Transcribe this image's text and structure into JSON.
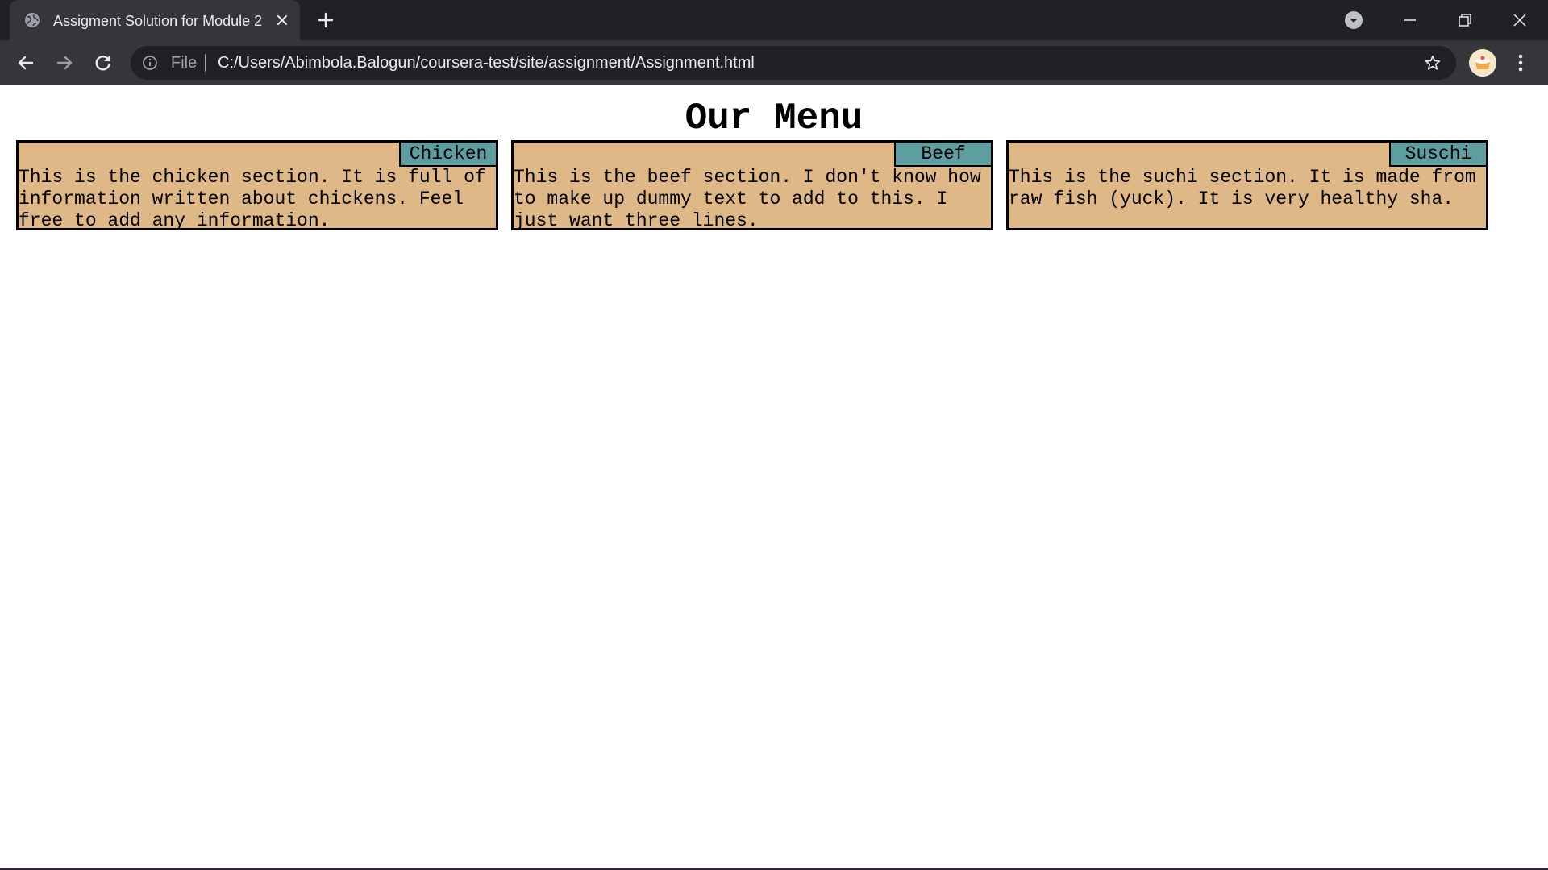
{
  "browser": {
    "tab_title": "Assigment Solution for Module 2",
    "omnibox": {
      "scheme_label": "File",
      "url": "C:/Users/Abimbola.Balogun/coursera-test/site/assignment/Assignment.html"
    },
    "colors": {
      "chrome_dark": "#202124",
      "chrome_toolbar": "#35363a",
      "chrome_text": "#e8eaed"
    },
    "icons": {
      "favicon": "globe-icon",
      "tab_close": "close-icon",
      "new_tab": "plus-icon",
      "profile_menu": "chevron-down-icon",
      "back": "arrow-left-icon",
      "forward": "arrow-right-icon",
      "reload": "reload-icon",
      "site_info": "info-icon",
      "bookmark": "star-icon",
      "menu": "kebab-menu-icon"
    }
  },
  "page": {
    "title": "Our Menu",
    "colors": {
      "section_background": "#deb887",
      "label_background": "#5f9ea0",
      "border": "#000000"
    },
    "sections": [
      {
        "label": "Chicken",
        "text": "This is the chicken section. It is full of information written about chickens. Feel free to add any information."
      },
      {
        "label": "Beef",
        "text": "This is the beef section. I don't know how to make up dummy text to add to this. I just want three lines."
      },
      {
        "label": "Suschi",
        "text": "This is the suchi section. It is made from raw fish (yuck). It is very healthy sha."
      }
    ]
  }
}
